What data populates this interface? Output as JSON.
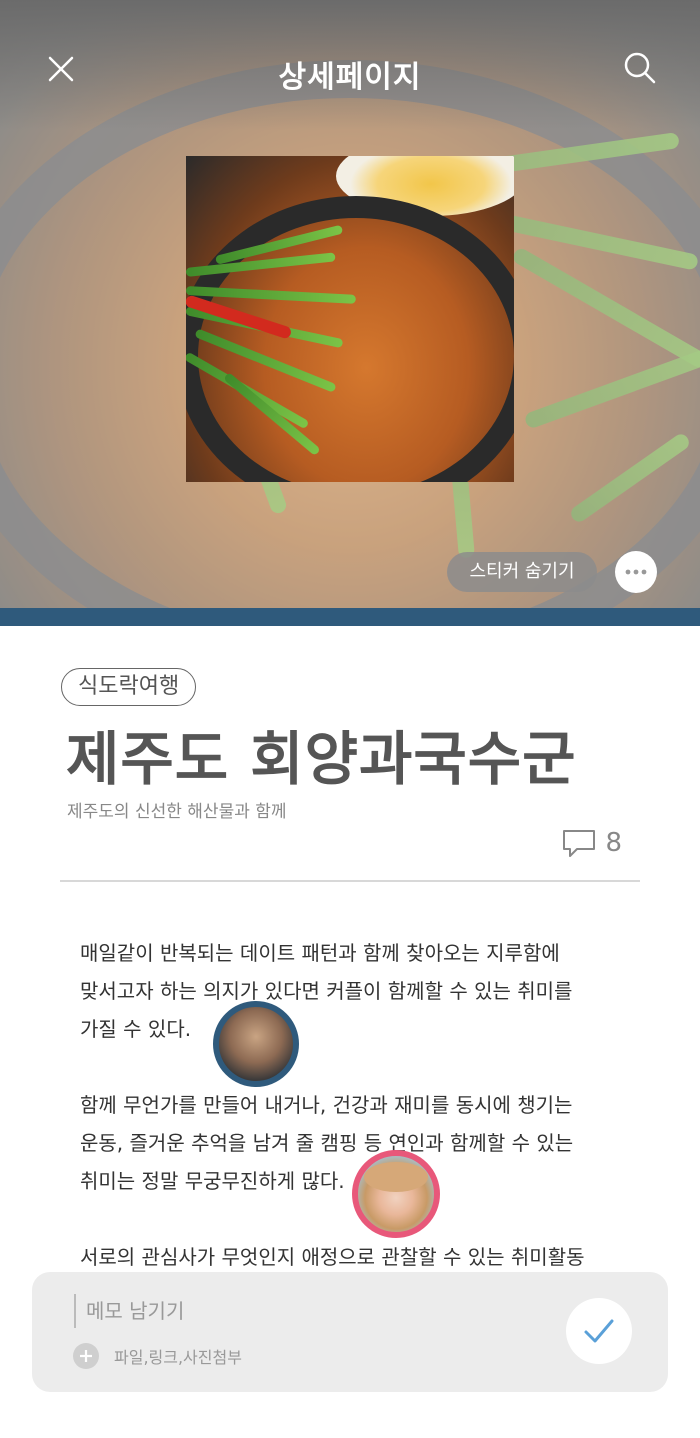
{
  "header": {
    "title": "상세페이지",
    "close_icon": "close-icon",
    "search_icon": "search-icon"
  },
  "hero": {
    "sticker_toggle_label": "스티커 숨기기",
    "more_icon": "more-horizontal-icon",
    "accent_color": "#2f5a7c"
  },
  "article": {
    "category": "식도락여행",
    "title": "제주도 회양과국수군",
    "subtitle": "제주도의 신선한 해산물과 함께",
    "comment_icon": "speech-bubble-icon",
    "comment_count": "8",
    "paragraphs": [
      [
        "매일같이 반복되는 데이트 패턴과 함께 찾아오는 지루함에",
        "맞서고자 하는 의지가 있다면 커플이 함께할 수 있는 취미를",
        "가질 수 있다."
      ],
      [
        "함께 무언가를 만들어 내거나, 건강과 재미를 동시에 챙기는",
        "운동, 즐거운 추억을 남겨 줄 캠핑 등 연인과 함께할 수 있는",
        "취미는 정말 무궁무진하게 많다."
      ],
      [
        "서로의 관심사가 무엇인지 애정으로 관찰할 수 있는 취미활동"
      ]
    ],
    "avatar_colors": [
      "#2f5a7c",
      "#e8587a"
    ]
  },
  "memo": {
    "placeholder": "메모 남기기",
    "attach_label": "파일,링크,사진첨부",
    "attach_icon": "plus-circle-icon",
    "submit_icon": "check-icon",
    "check_color": "#5aa0d8"
  }
}
